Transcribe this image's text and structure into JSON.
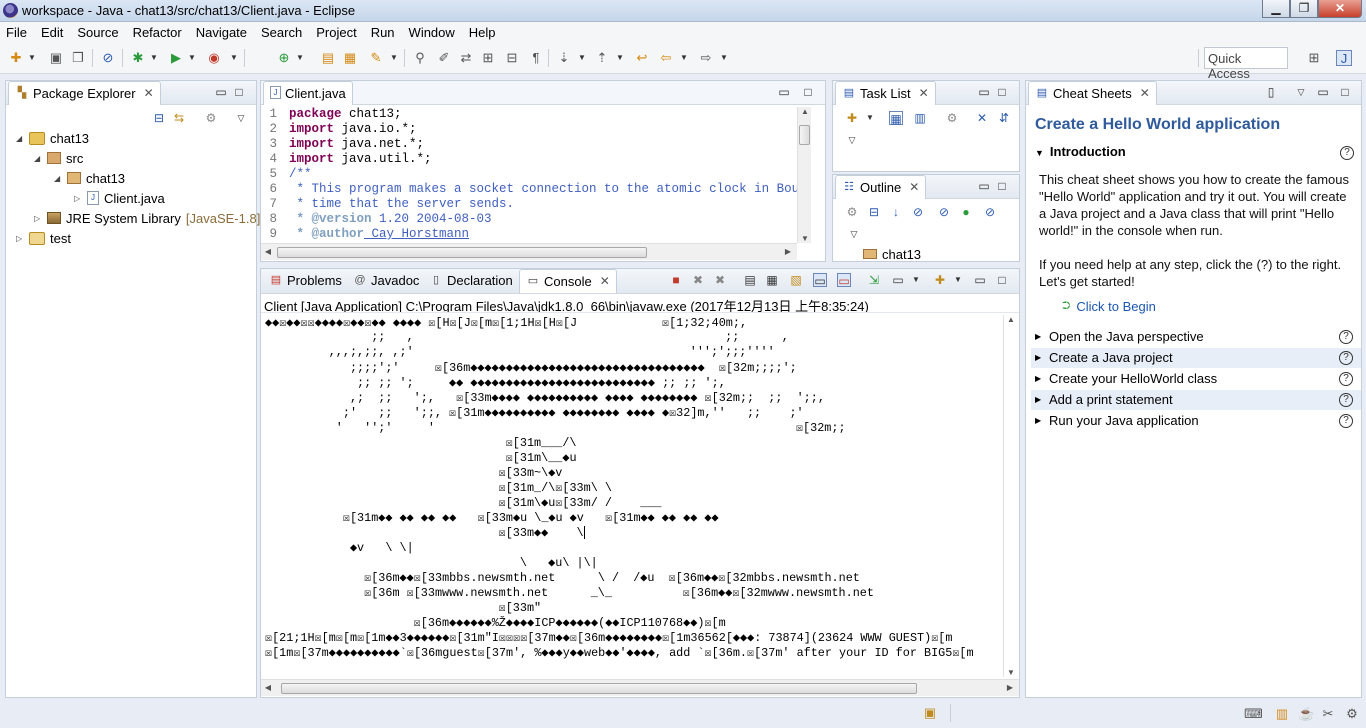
{
  "window": {
    "title": "workspace - Java - chat13/src/chat13/Client.java - Eclipse",
    "minimize": "▁",
    "maximize": "❐",
    "close": "✕"
  },
  "menu": [
    "File",
    "Edit",
    "Source",
    "Refactor",
    "Navigate",
    "Search",
    "Project",
    "Run",
    "Window",
    "Help"
  ],
  "toolbar": {
    "quick_access": "Quick Access"
  },
  "package_explorer": {
    "tab_label": "Package Explorer",
    "tree": {
      "project": "chat13",
      "src": "src",
      "package": "chat13",
      "file": "Client.java",
      "jre_label": "JRE System Library",
      "jre_version": "[JavaSE-1.8]",
      "test_project": "test"
    }
  },
  "editor": {
    "tab_label": "Client.java",
    "lines": [
      {
        "n": "1",
        "kw": "package",
        "rest": " chat13;"
      },
      {
        "n": "2",
        "kw": "import",
        "rest": " java.io.*;"
      },
      {
        "n": "3",
        "kw": "import",
        "rest": " java.net.*;"
      },
      {
        "n": "4",
        "kw": "import",
        "rest": " java.util.*;"
      },
      {
        "n": "5",
        "cm": "/**"
      },
      {
        "n": "6",
        "cm": " * This program makes a socket connection to the atomic clock in Boulde"
      },
      {
        "n": "7",
        "cm": " * time that the server sends."
      },
      {
        "n": "8",
        "tag": " * @version",
        "cm_rest": " 1.20 2004-08-03"
      },
      {
        "n": "9",
        "tag": " * @author",
        "cm_rest": " Cay Horstmann"
      }
    ]
  },
  "task_list": {
    "tab_label": "Task List"
  },
  "outline": {
    "tab_label": "Outline",
    "item": "chat13"
  },
  "bottom_tabs": {
    "problems": "Problems",
    "javadoc": "Javadoc",
    "declaration": "Declaration",
    "console": "Console"
  },
  "console": {
    "header": "Client [Java Application] C:\\Program Files\\Java\\jdk1.8.0_66\\bin\\javaw.exe (2017年12月13日 上午8:35:24)",
    "lines": [
      "◆◆☒◆◆☒☒◆◆◆◆☒◆◆☒◆◆ ◆◆◆◆ ☒[H☒[J☒[m☒[1;1H☒[H☒[J            ☒[1;32;40m;,",
      "               ;;   ,                                            ;;      ,",
      "         ,,,;,;;, ,;'                                       ''';';;;''''",
      "            ;;;;';'     ☒[36m◆◆◆◆◆◆◆◆◆◆◆◆◆◆◆◆◆◆◆◆◆◆◆◆◆◆◆◆◆◆◆◆◆  ☒[32m;;;;';",
      "             ;; ;; ';     ◆◆ ◆◆◆◆◆◆◆◆◆◆◆◆◆◆◆◆◆◆◆◆◆◆◆◆◆◆ ;; ;; ';,",
      "            ,;  ;;   ';,   ☒[33m◆◆◆◆ ◆◆◆◆◆◆◆◆◆◆ ◆◆◆◆ ◆◆◆◆◆◆◆◆ ☒[32m;;  ;;  ';;,",
      "           ;'   ;;   ';;, ☒[31m◆◆◆◆◆◆◆◆◆◆ ◆◆◆◆◆◆◆◆ ◆◆◆◆ ◆☒32]m,''   ;;    ;'",
      "          '   '';'     '                                                   ☒[32m;;",
      "                                  ☒[31m___/\\",
      "                                  ☒[31m\\__◆u",
      "                                 ☒[33m~\\◆v",
      "                                 ☒[31m_/\\☒[33m\\ \\",
      "                                 ☒[31m\\◆u☒[33m/ /    ___",
      "           ☒[31m◆◆ ◆◆ ◆◆ ◆◆   ☒[33m◆u \\_◆u ◆v   ☒[31m◆◆ ◆◆ ◆◆ ◆◆",
      "                                 ☒[33m◆◆    \\",
      "            ◆v   \\ \\|",
      "                                    \\   ◆u\\ |\\|",
      "              ☒[36m◆◆☒[33mbbs.newsmth.net      \\ /  /◆u  ☒[36m◆◆☒[32mbbs.newsmth.net",
      "              ☒[36m ☒[33mwww.newsmth.net      _\\_          ☒[36m◆◆☒[32mwww.newsmth.net",
      "                                 ☒[33m\"",
      "                     ☒[36m◆◆◆◆◆◆%Ž◆◆◆◆ICP◆◆◆◆◆◆(◆◆ICP110768◆◆)☒[m",
      "☒[21;1H☒[m☒[m☒[1m◆◆3◆◆◆◆◆◆☒[31m\"I☒☒☒☒[37m◆◆☒[36m◆◆◆◆◆◆◆◆☒[1m36562[◆◆◆: 73874](23624 WWW GUEST)☒[m",
      "☒[1m☒[37m◆◆◆◆◆◆◆◆◆◆`☒[36mguest☒[37m', %◆◆◆y◆◆web◆◆'◆◆◆◆, add `☒[36m.☒[37m' after your ID for BIG5☒[m"
    ]
  },
  "cheat_sheets": {
    "tab_label": "Cheat Sheets",
    "title": "Create a Hello World application",
    "intro_heading": "Introduction",
    "intro_text": "This cheat sheet shows you how to create the famous \"Hello World\" application and try it out. You will create a Java project and a Java class that will print \"Hello world!\" in the console when run.",
    "help_text": "If you need help at any step, click the (?) to the right. Let's get started!",
    "click_to_begin": "Click to Begin",
    "steps": [
      "Open the Java perspective",
      "Create a Java project",
      "Create your HelloWorld class",
      "Add a print statement",
      "Run your Java application"
    ]
  }
}
